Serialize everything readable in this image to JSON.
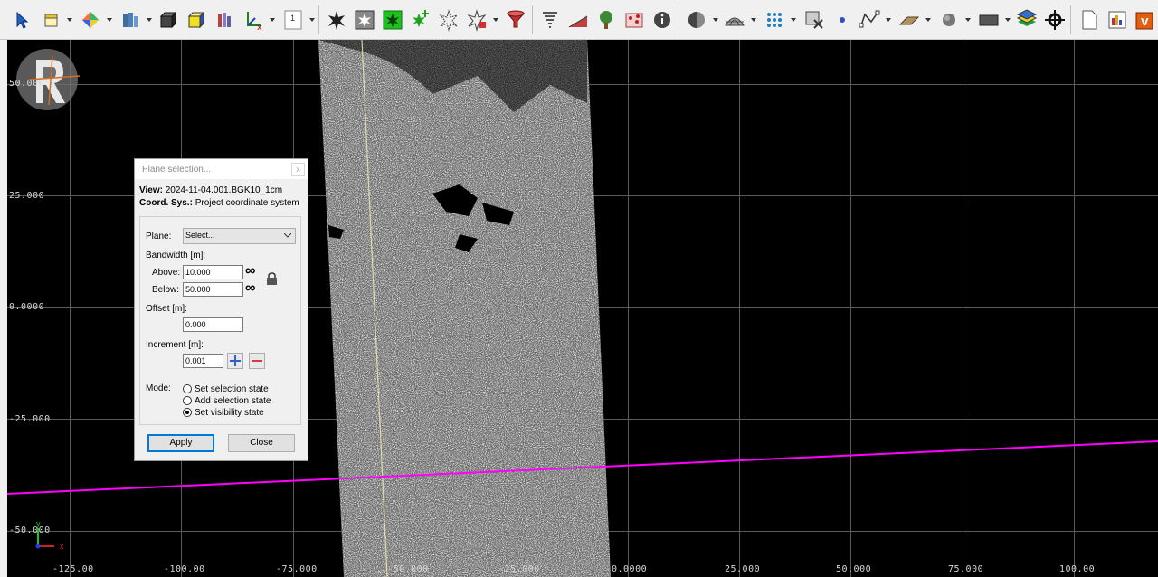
{
  "toolbar": {
    "tools": [
      {
        "icon": "select-cursor-icon"
      },
      {
        "icon": "box-view-icon"
      },
      {
        "icon": "color-mode-icon"
      },
      {
        "icon": "dataset-filter-icon"
      },
      {
        "icon": "cube-dark-icon"
      },
      {
        "icon": "cube-yellow-icon"
      },
      {
        "icon": "layers-bars-icon"
      },
      {
        "icon": "axis-xyz-icon"
      },
      {
        "icon": "page-one-icon",
        "text": "1"
      },
      {
        "icon": "star-burst-icon"
      },
      {
        "icon": "star-box-icon"
      },
      {
        "icon": "star-green-icon"
      },
      {
        "icon": "star-add-icon"
      },
      {
        "icon": "star-outline-icon"
      },
      {
        "icon": "star-edit-icon"
      },
      {
        "icon": "filter-funnel-icon"
      },
      {
        "icon": "tornado-icon"
      },
      {
        "icon": "height-ramp-icon"
      },
      {
        "icon": "tree-icon"
      },
      {
        "icon": "map-pins-icon"
      },
      {
        "icon": "info-icon"
      },
      {
        "icon": "half-sphere-icon"
      },
      {
        "icon": "mesh-dome-icon"
      },
      {
        "icon": "point-grid-icon"
      },
      {
        "icon": "select-remove-icon"
      },
      {
        "icon": "point-dot-icon"
      },
      {
        "icon": "polyline-icon"
      },
      {
        "icon": "plane-icon"
      },
      {
        "icon": "sphere-icon"
      },
      {
        "icon": "rectangle-icon"
      },
      {
        "icon": "layer-stack-icon"
      },
      {
        "icon": "crosshair-icon"
      },
      {
        "icon": "document-edit-icon"
      },
      {
        "icon": "report-chart-icon"
      },
      {
        "icon": "vector-app-icon"
      }
    ]
  },
  "viewport": {
    "y_labels": [
      "50.000",
      "25.000",
      "0.0000",
      "-25.000",
      "-50.000"
    ],
    "x_labels": [
      "-125.00",
      "-100.00",
      "-75.000",
      "-50.000",
      "-25.000",
      "0.0000",
      "25.000",
      "50.000",
      "75.000",
      "100.00"
    ],
    "axis_triad": {
      "x": "x",
      "y": "y"
    },
    "line_color": "#ff00ff",
    "grid_color": "#5a5a5a"
  },
  "dialog": {
    "title": "Plane selection...",
    "close": "x",
    "view_label": "View:",
    "view_value": "2024-11-04.001.BGK10_1cm",
    "coord_label": "Coord. Sys.:",
    "coord_value": "Project coordinate system",
    "plane_label": "Plane:",
    "plane_value": "Select...",
    "bandwidth_label": "Bandwidth [m]:",
    "above_label": "Above:",
    "above_value": "10.000",
    "below_label": "Below:",
    "below_value": "50.000",
    "infinity": "∞",
    "offset_label": "Offset [m]:",
    "offset_value": "0.000",
    "increment_label": "Increment [m]:",
    "increment_value": "0.001",
    "mode_label": "Mode:",
    "modes": [
      {
        "label": "Set selection state",
        "selected": false
      },
      {
        "label": "Add selection state",
        "selected": false
      },
      {
        "label": "Set visibility state",
        "selected": true
      }
    ],
    "apply": "Apply",
    "close_button": "Close"
  }
}
